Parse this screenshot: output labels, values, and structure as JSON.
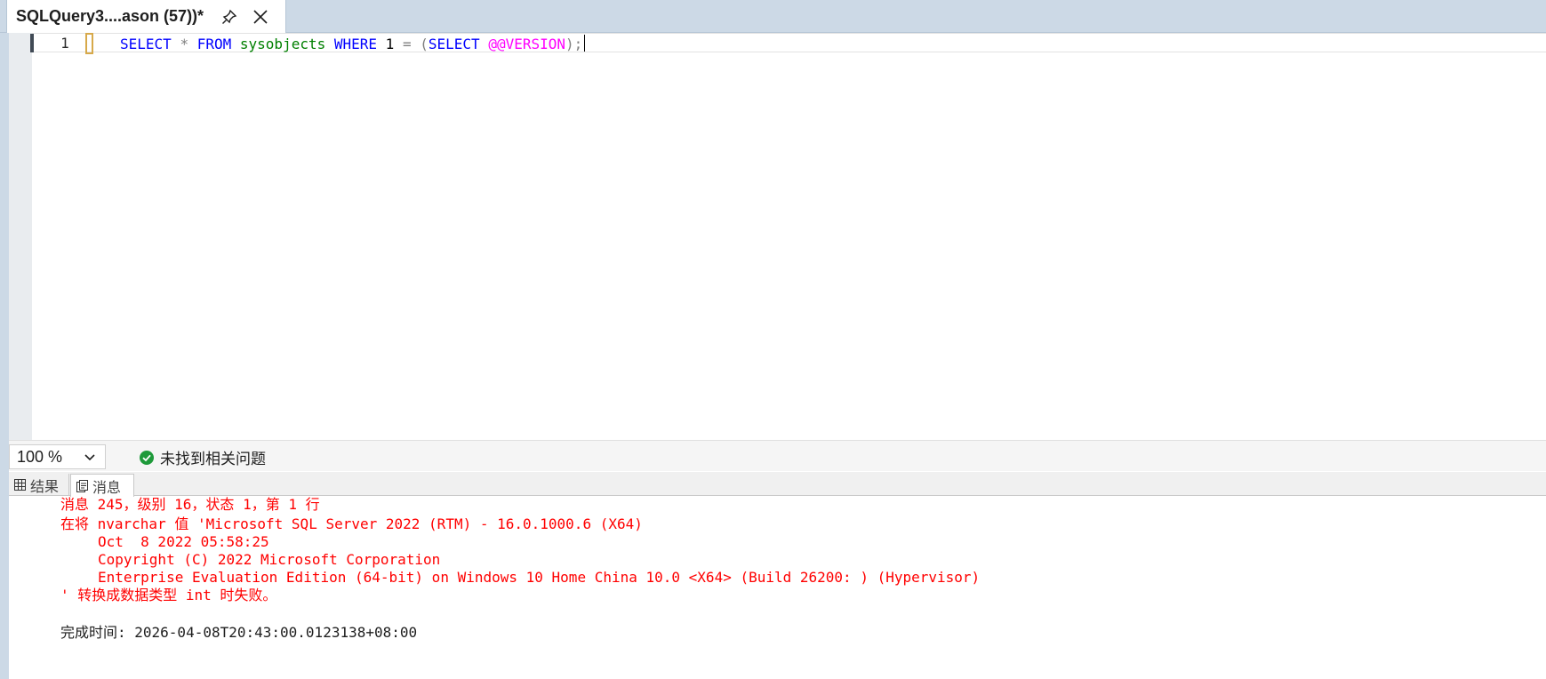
{
  "tab": {
    "title": "SQLQuery3....ason (57))*"
  },
  "editor": {
    "line_number": "1",
    "code": {
      "select": "SELECT",
      "star": "*",
      "from": "FROM",
      "table": "sysobjects",
      "where": "WHERE",
      "one": "1",
      "eq": "=",
      "lparen": "(",
      "select2": "SELECT",
      "version": "@@VERSION",
      "rparen": ")",
      "semi": ";"
    }
  },
  "status_bar": {
    "zoom": "100 %",
    "issues_text": "未找到相关问题"
  },
  "result_tabs": [
    {
      "label": "结果",
      "icon": "grid-icon"
    },
    {
      "label": "消息",
      "icon": "message-icon"
    }
  ],
  "messages": {
    "line1": "消息 245，级别 16，状态 1，第 1 行",
    "line2": "在将 nvarchar 值 'Microsoft SQL Server 2022 (RTM) - 16.0.1000.6 (X64)",
    "line3": "Oct  8 2022 05:58:25",
    "line4": "Copyright (C) 2022 Microsoft Corporation",
    "line5": "Enterprise Evaluation Edition (64-bit) on Windows 10 Home China 10.0 <X64> (Build 26200: ) (Hypervisor)",
    "line6": "' 转换成数据类型 int 时失败。",
    "completion": "完成时间: 2026-04-08T20:43:00.0123138+08:00"
  },
  "colors": {
    "keyword": "#0000ff",
    "table": "#008000",
    "system_var": "#ff00ff",
    "error_text": "#ff0000",
    "success": "#1e9a3a",
    "tab_strip": "#ccd9e6"
  }
}
